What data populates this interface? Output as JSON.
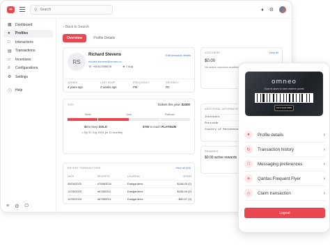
{
  "topbar": {
    "logo_text": "∞",
    "search_placeholder": "Search"
  },
  "sidebar": {
    "items": [
      {
        "label": "Dashboard",
        "icon": "grid-icon"
      },
      {
        "label": "Profiles",
        "icon": "user-icon",
        "active": true
      },
      {
        "label": "Interactions",
        "icon": "chat-icon"
      },
      {
        "label": "Transactions",
        "icon": "receipt-icon"
      },
      {
        "label": "Incentives",
        "icon": "gift-icon"
      },
      {
        "label": "Configurations",
        "icon": "sliders-icon"
      },
      {
        "label": "Settings",
        "icon": "gear-icon"
      }
    ],
    "help_label": "Help"
  },
  "main": {
    "back_label": "Back to Search",
    "tabs": [
      {
        "label": "Overview",
        "active": true
      },
      {
        "label": "Profile Details",
        "active": false
      }
    ]
  },
  "profile": {
    "initials": "RS",
    "name": "Richard Stevens",
    "email": "richard.stevens@omneo.io",
    "phone": "+61412345678",
    "birthday": "7 Aug",
    "edit_label": "Edit personal details",
    "stats": [
      {
        "label": "Joined",
        "value": "4 years ago"
      },
      {
        "label": "Last shop",
        "value": "2 weeks ago"
      },
      {
        "label": "Frequency",
        "value": "PM"
      },
      {
        "label": "Recency",
        "value": "RC"
      }
    ]
  },
  "tier": {
    "label": "Tier",
    "dollars_prefix": "Dollars this year:",
    "dollars_value": "$2300",
    "levels": [
      "Silver",
      "Gold",
      "Platinum"
    ],
    "progress_segments_filled": 2,
    "progress_segments_total": 4,
    "goal1_amount": "$0",
    "goal1_mid": "to keep",
    "goal1_level": "GOLD",
    "goal2_amount": "$700",
    "goal2_mid": "to reach",
    "goal2_level": "PLATINUM",
    "by_date": "By 31 July 2024 (in 10 months)"
  },
  "transactions": {
    "label": "Recent transactions",
    "view_all": "View all (48)",
    "headers": [
      "Date",
      "Receipts",
      "Location",
      "Spend"
    ],
    "rows": [
      {
        "date": "06/04/2023",
        "receipt": "#76683234",
        "location": "Eastgardens",
        "spend": "$158.40 (2)"
      },
      {
        "date": "12/30/2023",
        "receipt": "#67830311",
        "location": "Eastgardens",
        "spend": "$158.40 (2)"
      },
      {
        "date": "12/30/2023",
        "receipt": "#67830011",
        "location": "Eastgardens",
        "spend": "-$69.97 (3)"
      }
    ]
  },
  "vouchers": {
    "label": "Vouchers",
    "view_all": "View all",
    "amount": "$0.00",
    "subtitle": "No active vouchers available"
  },
  "additional": {
    "label": "Additional information",
    "rows": [
      "Interests",
      "Postcode",
      "Country of Residence"
    ]
  },
  "rewards": {
    "label": "Rewards",
    "amount": "$0.00 active rewards"
  },
  "phone": {
    "brand": "omneo",
    "scan_text": "Scan in-store to earn redeem points",
    "wallet_text": "Add to Apple Wallet",
    "menu": [
      {
        "label": "Profile details",
        "icon": "person-icon"
      },
      {
        "label": "Transaction history",
        "icon": "history-icon"
      },
      {
        "label": "Messaging preferences",
        "icon": "message-icon"
      },
      {
        "label": "Qantas Frequent Flyer",
        "icon": "plane-icon"
      },
      {
        "label": "Claim transaction",
        "icon": "tag-icon"
      }
    ],
    "logout_label": "Logout"
  },
  "colors": {
    "accent": "#e8474f",
    "link": "#3d78c9"
  }
}
